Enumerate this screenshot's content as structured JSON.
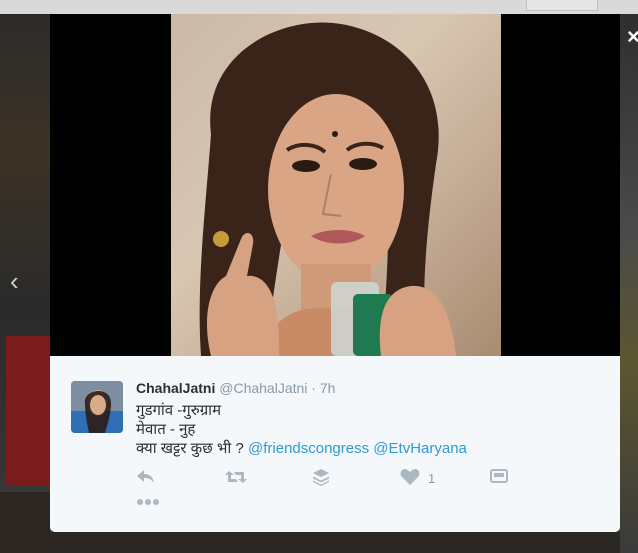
{
  "viewer": {
    "close_label": "×",
    "prev_label": "‹"
  },
  "tweet": {
    "display_name": "ChahalJatni",
    "username": "@ChahalJatni",
    "separator": "·",
    "timestamp": "7h",
    "lines": [
      "गुडगांव -गुरुग्राम",
      "मेवात - नुह",
      "क्या खट्टर कुछ भी ?"
    ],
    "mentions": [
      "@friendscongress",
      "@EtvHaryana"
    ],
    "like_count": "1"
  },
  "icons": {
    "reply": "reply-icon",
    "retweet": "retweet-icon",
    "stack": "layers-icon",
    "like": "heart-icon",
    "card": "card-icon",
    "more": "more-icon"
  },
  "colors": {
    "link": "#2e9ad6",
    "icon": "#aab8c2",
    "card_bg": "#f5f8fa"
  }
}
